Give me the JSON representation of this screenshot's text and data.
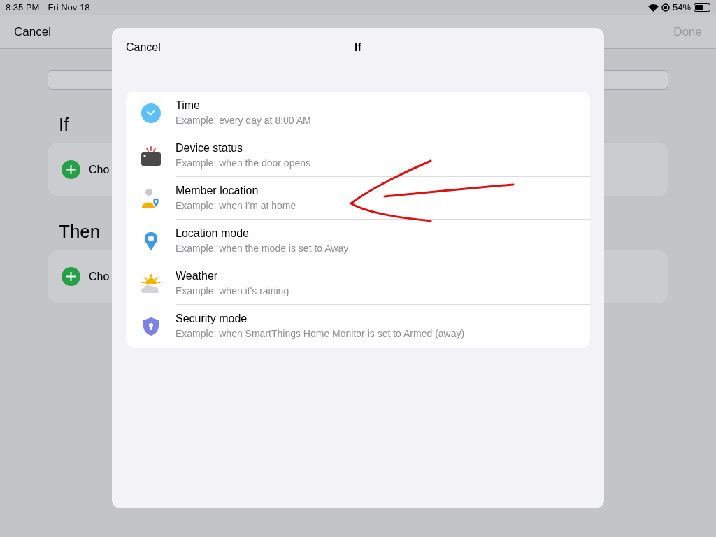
{
  "status_bar": {
    "time": "8:35 PM",
    "date": "Fri Nov 18",
    "battery_text": "54%",
    "battery": {
      "level": 0.54
    }
  },
  "background": {
    "nav": {
      "cancel": "Cancel",
      "done": "Done",
      "done_disabled": true
    },
    "sections": [
      {
        "heading": "If",
        "action": "Cho"
      },
      {
        "heading": "Then",
        "action": "Cho"
      }
    ]
  },
  "dialog": {
    "cancel": "Cancel",
    "title": "If",
    "items": [
      {
        "kind": "time",
        "title": "Time",
        "example": "Example: every day at 8:00 AM"
      },
      {
        "kind": "device",
        "title": "Device status",
        "example": "Example: when the door opens"
      },
      {
        "kind": "member",
        "title": "Member location",
        "example": "Example: when I'm at home"
      },
      {
        "kind": "location",
        "title": "Location mode",
        "example": "Example: when the mode is set to Away"
      },
      {
        "kind": "weather",
        "title": "Weather",
        "example": "Example: when it's raining"
      },
      {
        "kind": "security",
        "title": "Security mode",
        "example": "Example: when SmartThings Home Monitor is set to Armed (away)"
      }
    ]
  }
}
